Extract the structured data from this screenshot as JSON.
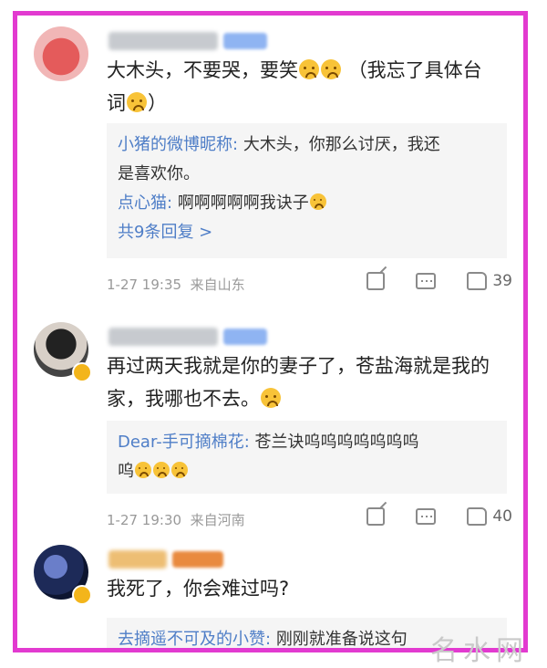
{
  "comments": [
    {
      "text": "大木头，不要哭，要笑",
      "text_suffix": "（我忘了具体台",
      "text_line2": "词",
      "text_line2_suffix": "）",
      "replies": [
        {
          "who": "小猪的微博昵称:",
          "text": "大木头，你那么讨厌，我还",
          "text2": "是喜欢你。"
        },
        {
          "who": "点心猫:",
          "text": "啊啊啊啊啊我诀子"
        }
      ],
      "more": "共9条回复 >",
      "time": "1-27 19:35",
      "location": "来自山东",
      "likes": "39"
    },
    {
      "text": "再过两天我就是你的妻子了，苍盐海就是我的",
      "text_line2": "家，我哪也不去。",
      "replies": [
        {
          "who": "Dear-手可摘棉花:",
          "text": "苍兰诀呜呜呜呜呜呜呜",
          "text2": "呜"
        }
      ],
      "time": "1-27 19:30",
      "location": "来自河南",
      "likes": "40"
    },
    {
      "text": "我死了，你会难过吗?",
      "replies": [
        {
          "who": "去摘遥不可及的小赞:",
          "text": "刚刚就准备说这句"
        }
      ]
    }
  ],
  "watermark": "名水网",
  "colors": {
    "frame": "#e23ad0",
    "link": "#4f7ec7"
  }
}
